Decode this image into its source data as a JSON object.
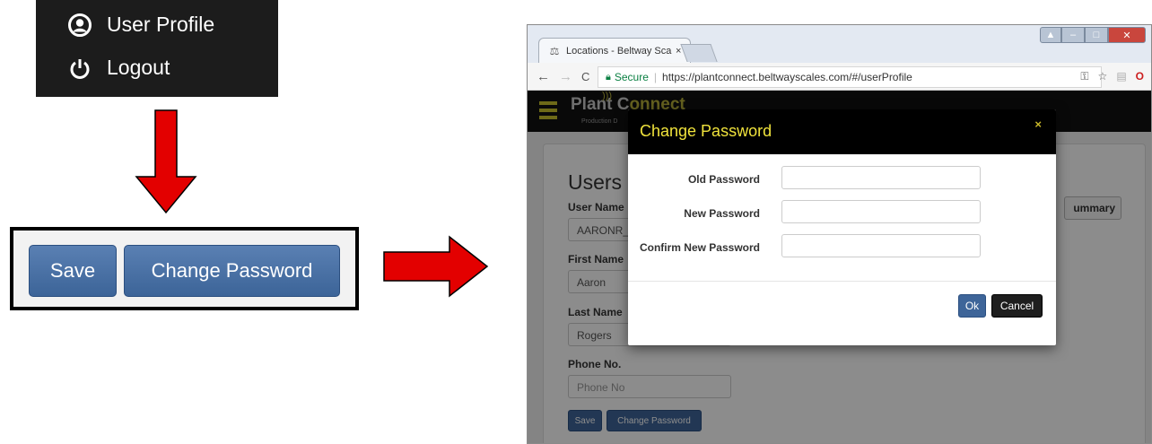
{
  "user_menu": {
    "items": [
      {
        "label": "User Profile",
        "icon": "user-circle-icon"
      },
      {
        "label": "Logout",
        "icon": "power-icon"
      }
    ]
  },
  "buttons_crop": {
    "save_label": "Save",
    "change_password_label": "Change Password"
  },
  "arrows": {
    "color": "#e30000"
  },
  "browser": {
    "tab_title": "Locations - Beltway Scale",
    "tab_close": "×",
    "secure_label": "Secure",
    "url": "https://plantconnect.beltwayscales.com/#/userProfile"
  },
  "app": {
    "logo_main": "Plant C",
    "logo_rest": "onnect",
    "logo_sub": "Production D",
    "accent_color": "#c9c12d"
  },
  "page": {
    "title": "Users P",
    "summary_label": "ummary",
    "fields": [
      {
        "label": "User Name",
        "value": "AARONR_",
        "placeholder": ""
      },
      {
        "label": "First Name",
        "value": "Aaron",
        "placeholder": ""
      },
      {
        "label": "Last Name",
        "value": "Rogers",
        "placeholder": ""
      },
      {
        "label": "Phone No.",
        "value": "",
        "placeholder": "Phone No"
      }
    ],
    "save_label": "Save",
    "change_password_label": "Change Password"
  },
  "modal": {
    "title": "Change Password",
    "close": "×",
    "fields": [
      {
        "label": "Old Password"
      },
      {
        "label": "New Password"
      },
      {
        "label": "Confirm New Password"
      }
    ],
    "ok_label": "Ok",
    "cancel_label": "Cancel",
    "title_color": "#f0e33c"
  }
}
